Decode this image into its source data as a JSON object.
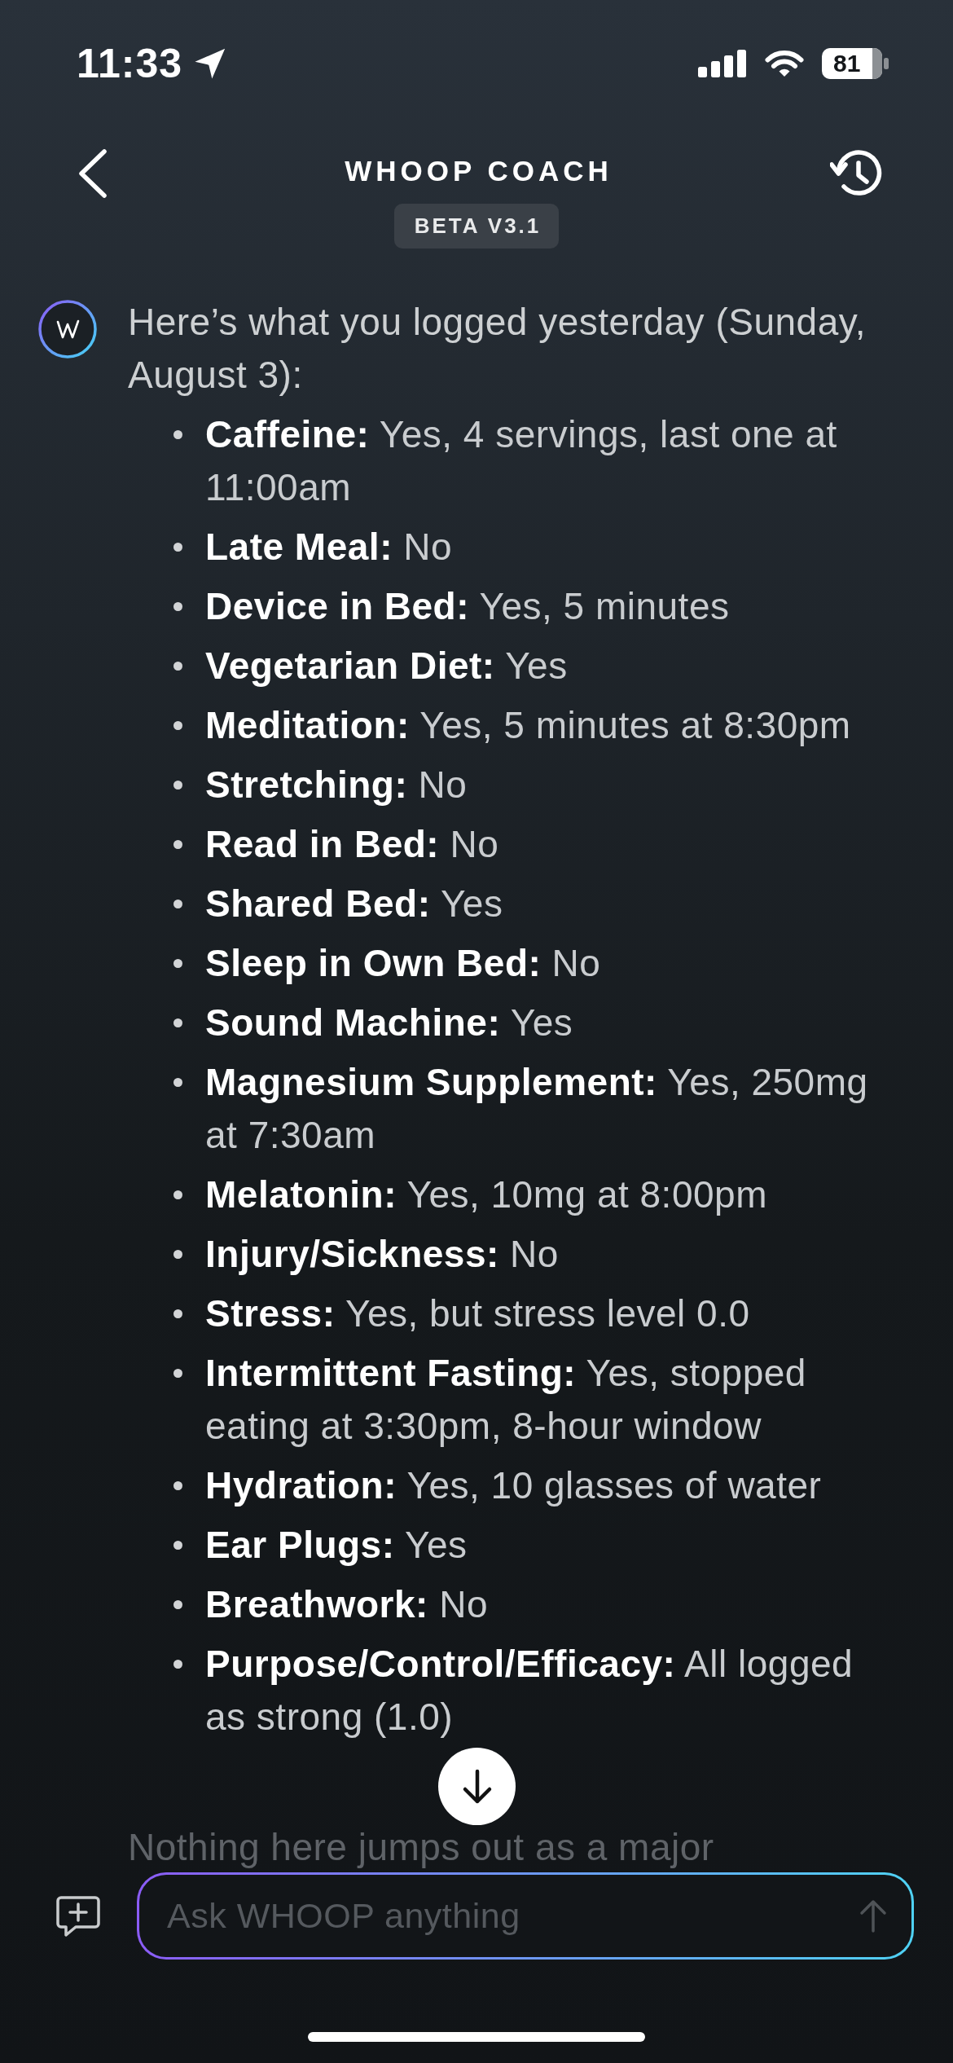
{
  "status_bar": {
    "time": "11:33",
    "battery": "81"
  },
  "header": {
    "title": "WHOOP COACH",
    "badge": "BETA V3.1"
  },
  "message": {
    "intro": "Here’s what you logged yesterday (Sunday, August 3):",
    "items": [
      "**Caffeine:** Yes, 4 servings, last one at 11:00am",
      "**Late Meal:** No",
      "**Device in Bed:** Yes, 5 minutes",
      "**Vegetarian Diet:** Yes",
      "**Meditation:** Yes, 5 minutes at 8:30pm",
      "**Stretching:** No",
      "**Read in Bed:** No",
      "**Shared Bed:** Yes",
      "**Sleep in Own Bed:** No",
      "**Sound Machine:** Yes",
      "**Magnesium Supplement:** Yes, 250mg at 7:30am",
      "**Melatonin:** Yes, 10mg at 8:00pm",
      "**Injury/Sickness:** No",
      "**Stress:** Yes, but stress level 0.0",
      "**Intermittent Fasting:** Yes, stopped eating at 3:30pm, 8-hour window",
      "**Hydration:** Yes, 10 glasses of water",
      "**Ear Plugs:** Yes",
      "**Breathwork:** No",
      "**Purpose/Control/Efficacy:** All logged as strong (1.0)"
    ],
    "outro": "Nothing here jumps out as a major"
  },
  "composer": {
    "placeholder": "Ask WHOOP anything"
  }
}
